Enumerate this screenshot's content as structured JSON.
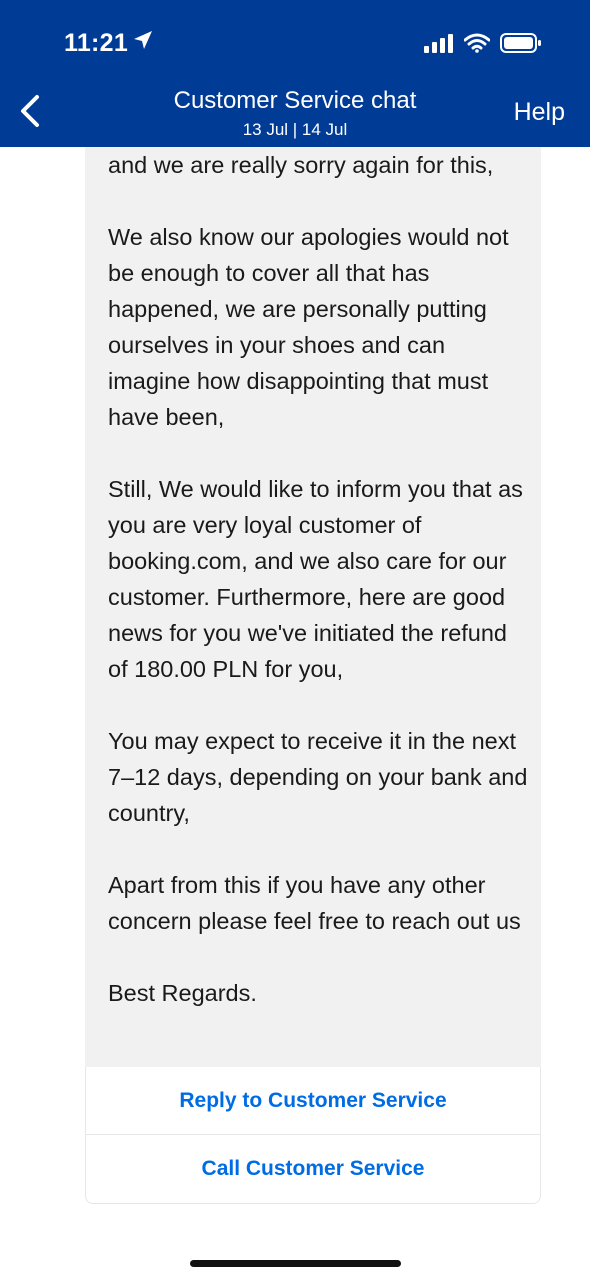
{
  "status_bar": {
    "time": "11:21",
    "icons": [
      "location-arrow-icon",
      "signal-icon",
      "wifi-icon",
      "battery-icon"
    ]
  },
  "nav": {
    "back_icon": "chevron-left-icon",
    "title": "Customer Service chat",
    "subtitle": "13 Jul | 14 Jul",
    "help_label": "Help"
  },
  "message": {
    "paragraphs": [
      "and we are really sorry again for this,",
      "We also know our apologies would not be enough to cover all that has happened, we are personally putting ourselves in your shoes and can imagine how disappointing that must have been,",
      "Still, We would like to inform you that as you are very loyal customer of booking.com, and we also care for our customer. Furthermore, here are good news for you we've initiated the refund of 180.00 PLN for you,",
      "You may expect to receive it in the next 7–12 days, depending on your bank and country,",
      "Apart from this if you have any other concern please feel free to reach out us",
      "Best Regards."
    ]
  },
  "actions": {
    "reply_label": "Reply to Customer Service",
    "call_label": "Call Customer Service"
  },
  "colors": {
    "header_bg": "#003b95",
    "link": "#006ce4",
    "bubble_bg": "#f1f1f1"
  }
}
